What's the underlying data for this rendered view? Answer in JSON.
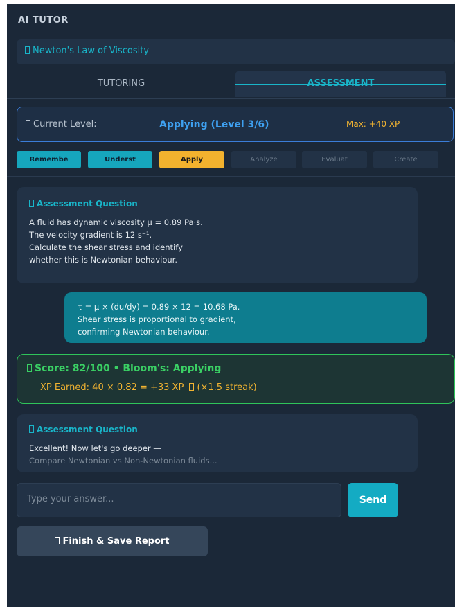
{
  "app": {
    "title": "AI TUTOR"
  },
  "topic": {
    "label": "Newton's Law of Viscosity"
  },
  "tabs": [
    {
      "label": "TUTORING",
      "active": false
    },
    {
      "label": "ASSESSMENT",
      "active": true
    }
  ],
  "level": {
    "label": "Current Level:",
    "value": "Applying  (Level 3/6)",
    "max_xp": "Max: +40 XP"
  },
  "bloom_levels": [
    {
      "label": "Remembe",
      "state": "done"
    },
    {
      "label": "Underst",
      "state": "done"
    },
    {
      "label": "Apply",
      "state": "current"
    },
    {
      "label": "Analyze",
      "state": "locked"
    },
    {
      "label": "Evaluat",
      "state": "locked"
    },
    {
      "label": "Create",
      "state": "locked"
    }
  ],
  "question1": {
    "title": "Assessment Question",
    "lines": [
      "A fluid has dynamic viscosity μ = 0.89 Pa·s.",
      "The velocity gradient is 12 s⁻¹.",
      "Calculate the shear stress and identify",
      "whether this is Newtonian behaviour."
    ]
  },
  "answer": {
    "lines": [
      "τ = μ × (du/dy) = 0.89 × 12 = 10.68 Pa.",
      "Shear stress is proportional to gradient,",
      "confirming Newtonian behaviour."
    ]
  },
  "score": {
    "line": "Score: 82/100  •  Bloom's: Applying",
    "xp_text": "XP Earned: 40 × 0.82 = +33 XP",
    "streak": "(×1.5 streak)"
  },
  "question2": {
    "title": "Assessment Question",
    "lines": [
      "Excellent! Now let's go deeper —",
      "Compare Newtonian vs Non-Newtonian fluids..."
    ]
  },
  "input": {
    "placeholder": "Type your answer..."
  },
  "send": {
    "label": "Send"
  },
  "finish": {
    "label": "Finish & Save Report"
  },
  "colors": {
    "background": "#1b2838",
    "card": "#223246",
    "accent": "#19b5c9",
    "gold": "#f2b431",
    "success": "#3ad064",
    "level_blue": "#3ea0f0"
  }
}
